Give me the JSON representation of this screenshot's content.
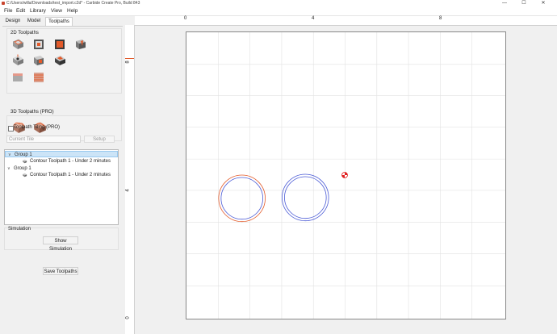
{
  "window": {
    "title": "C:/Users/willa/Downloads/test_import.c2d* - Carbide Create Pro, Build 843",
    "minimize": "—",
    "maximize": "☐",
    "close": "✕"
  },
  "menu": [
    "File",
    "Edit",
    "Library",
    "View",
    "Help"
  ],
  "tabs": [
    "Design",
    "Model",
    "Toolpaths"
  ],
  "active_tab": "Toolpaths",
  "toolpaths_2d": {
    "label": "2D Toolpaths",
    "icons": [
      "contour-toolpath-icon",
      "pocket-toolpath-icon",
      "advanced-vcarve-icon",
      "vcarve-toolpath-icon",
      "drill-toolpath-icon",
      "texture-toolpath-icon",
      "engrave-toolpath-icon",
      "chamfer-toolpath-icon",
      "facing-toolpath-icon",
      "rough-toolpath-icon"
    ]
  },
  "toolpaths_3d": {
    "label": "3D Toolpaths (PRO)",
    "icons": [
      "3d-rough-icon",
      "3d-finish-icon"
    ]
  },
  "tiling": {
    "label": "Toolpath Tiling (PRO)",
    "checked": false,
    "current_tile_placeholder": "Current Tile",
    "setup_label": "Setup"
  },
  "tree": [
    {
      "type": "group",
      "label": "Group 1",
      "chevron": "∨",
      "selected": true
    },
    {
      "type": "item",
      "label": "Contour Toolpath 1 - Under 2 minutes"
    },
    {
      "type": "group",
      "label": "Group 1",
      "chevron": "∨",
      "selected": false
    },
    {
      "type": "item",
      "label": "Contour Toolpath 1 - Under 2 minutes"
    }
  ],
  "simulation": {
    "label": "Simulation",
    "show_button": "Show Simulation"
  },
  "save_toolpaths": "Save Toolpaths",
  "rulers": {
    "top_labels": [
      "0",
      "4",
      "8"
    ],
    "left_labels": [
      "8",
      "4",
      "0"
    ]
  },
  "colors": {
    "accent": "#e35a2a",
    "vector_blue": "#4b5bd6",
    "toolpath_orange": "#e35a2a"
  }
}
